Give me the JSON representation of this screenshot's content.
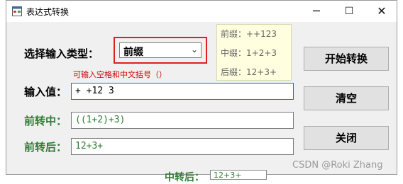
{
  "window": {
    "title": "表达式转换",
    "controls": {
      "minimize": "─",
      "maximize": "☐",
      "close": "✕"
    }
  },
  "form": {
    "input_type_label": "选择输入类型：",
    "input_type_selected": "前缀",
    "hint": "可输入空格和中文括号（）",
    "input_label": "输入值：",
    "input_value": "+ +12 3",
    "prefix_to_infix_label": "前转中：",
    "prefix_to_infix_value": "((1+2)+3)",
    "prefix_to_postfix_label": "前转后：",
    "prefix_to_postfix_value": "12+3+"
  },
  "buttons": {
    "start": "开始转换",
    "clear": "清空",
    "close": "关闭"
  },
  "examples": {
    "prefix": "前缀：++123",
    "infix": "中缀：1+2+3",
    "postfix": "后缀：12+3+"
  },
  "background_bleed": {
    "label": "中转后：",
    "value": "12+3+"
  },
  "watermark": "CSDN @Roki Zhang",
  "colors": {
    "result_green": "#2e7d32",
    "hint_red": "#d00000",
    "focus_blue": "#0078d7",
    "highlight_red": "#e02020"
  },
  "icons": {
    "app": "app-form-icon",
    "dropdown": "chevron-down-icon"
  }
}
